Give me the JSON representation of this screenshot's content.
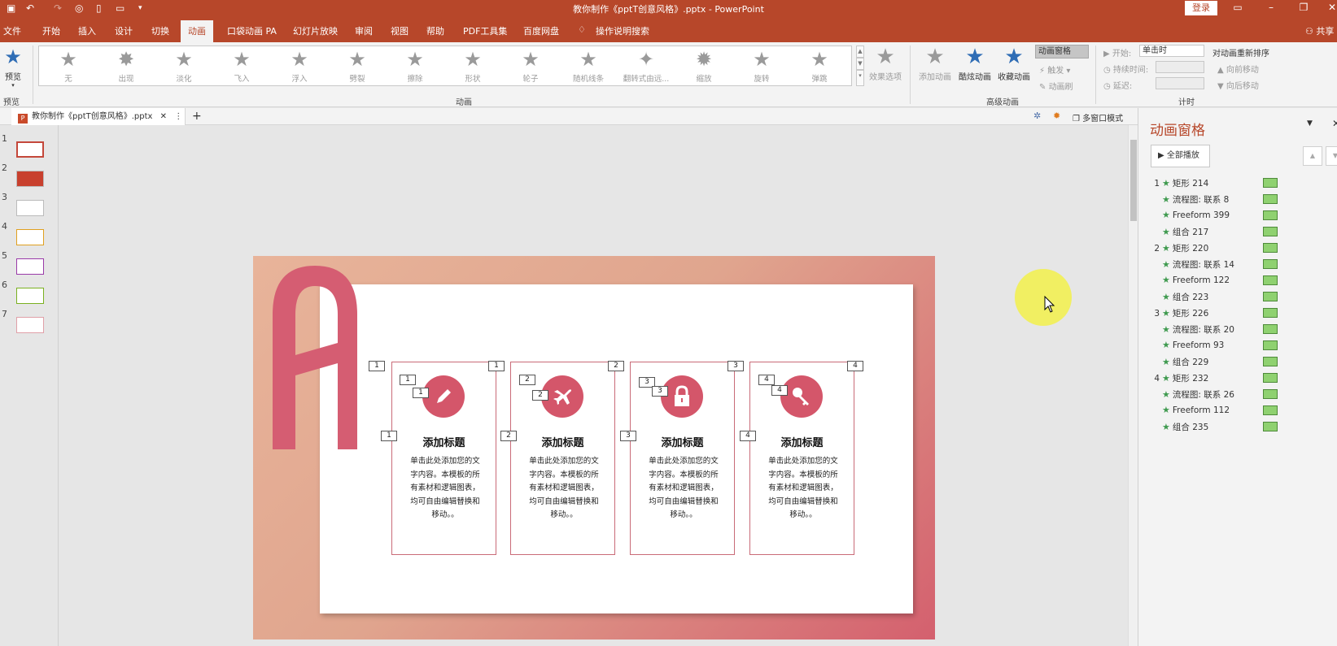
{
  "window": {
    "title": "教你制作《pptT创意风格》.pptx  -  PowerPoint",
    "login_label": "登录"
  },
  "menu": {
    "tabs": [
      "文件",
      "开始",
      "插入",
      "设计",
      "切换",
      "动画",
      "口袋动画 PA",
      "幻灯片放映",
      "审阅",
      "视图",
      "帮助",
      "PDF工具集",
      "百度网盘"
    ],
    "active": "动画",
    "tell_me": "操作说明搜索",
    "share": "共享"
  },
  "ribbon": {
    "preview_label": "预览",
    "preview_group": "预览",
    "animations": [
      "无",
      "出现",
      "淡化",
      "飞入",
      "浮入",
      "劈裂",
      "擦除",
      "形状",
      "轮子",
      "随机线条",
      "翻转式由远...",
      "缩放",
      "旋转",
      "弹跳"
    ],
    "effect_options": "效果选项",
    "animation_group": "动画",
    "add_animation": "添加动画",
    "cool_animation": "酷炫动画",
    "fav_animation": "收藏动画",
    "animation_pane": "动画窗格",
    "trigger": "触发",
    "animation_painter": "动画刷",
    "advanced_group": "高级动画",
    "start_label": "开始:",
    "start_value": "单击时",
    "duration_label": "持续时间:",
    "delay_label": "延迟:",
    "reorder_label": "对动画重新排序",
    "move_earlier": "向前移动",
    "move_later": "向后移动",
    "timing_group": "计时"
  },
  "doc_tab": {
    "name": "教你制作《pptT创意风格》.pptx",
    "multi_window": "多窗口模式"
  },
  "thumbnails": [
    "1",
    "2",
    "3",
    "4",
    "5",
    "6",
    "7"
  ],
  "slide": {
    "cards": [
      {
        "tag": "1",
        "title": "添加标题",
        "icon": "pencil-icon",
        "body": "单击此处添加您的文字内容。本模板的所有素材和逻辑图表，均可自由编辑替换和移动。。"
      },
      {
        "tag": "2",
        "title": "添加标题",
        "icon": "airplane-icon",
        "body": "单击此处添加您的文字内容。本模板的所有素材和逻辑图表，均可自由编辑替换和移动。。"
      },
      {
        "tag": "3",
        "title": "添加标题",
        "icon": "lock-icon",
        "body": "单击此处添加您的文字内容。本模板的所有素材和逻辑图表，均可自由编辑替换和移动。。"
      },
      {
        "tag": "4",
        "title": "添加标题",
        "icon": "key-icon",
        "body": "单击此处添加您的文字内容。本模板的所有素材和逻辑图表，均可自由编辑替换和移动。。"
      }
    ]
  },
  "animation_pane": {
    "title": "动画窗格",
    "play_all": "全部播放",
    "items": [
      {
        "num": "1",
        "name": "矩形 214"
      },
      {
        "num": "",
        "name": "流程图: 联系 8"
      },
      {
        "num": "",
        "name": "Freeform 399"
      },
      {
        "num": "",
        "name": "组合 217"
      },
      {
        "num": "2",
        "name": "矩形 220"
      },
      {
        "num": "",
        "name": "流程图: 联系 14"
      },
      {
        "num": "",
        "name": "Freeform 122"
      },
      {
        "num": "",
        "name": "组合 223"
      },
      {
        "num": "3",
        "name": "矩形 226"
      },
      {
        "num": "",
        "name": "流程图: 联系 20"
      },
      {
        "num": "",
        "name": "Freeform 93"
      },
      {
        "num": "",
        "name": "组合 229"
      },
      {
        "num": "4",
        "name": "矩形 232"
      },
      {
        "num": "",
        "name": "流程图: 联系 26"
      },
      {
        "num": "",
        "name": "Freeform 112"
      },
      {
        "num": "",
        "name": "组合 235"
      }
    ]
  },
  "colors": {
    "brand": "#b7472a",
    "accent": "#d4566a",
    "effect_bar": "#8fd170"
  }
}
